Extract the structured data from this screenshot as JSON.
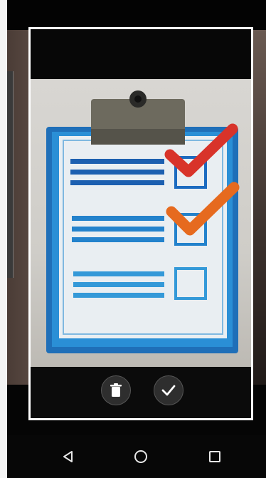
{
  "screen": {
    "mode": "document-scan-review"
  },
  "actions": {
    "delete_icon": "trash-icon",
    "confirm_icon": "checkmark-icon"
  },
  "navigation": {
    "back_icon": "triangle-back-icon",
    "home_icon": "circle-home-icon",
    "recents_icon": "square-recents-icon"
  },
  "colors": {
    "frame": "#ffffff",
    "background": "#050505",
    "clipboard_blue": "#1f7fc4",
    "check_red": "#d8332a",
    "check_orange": "#e66a1f"
  }
}
